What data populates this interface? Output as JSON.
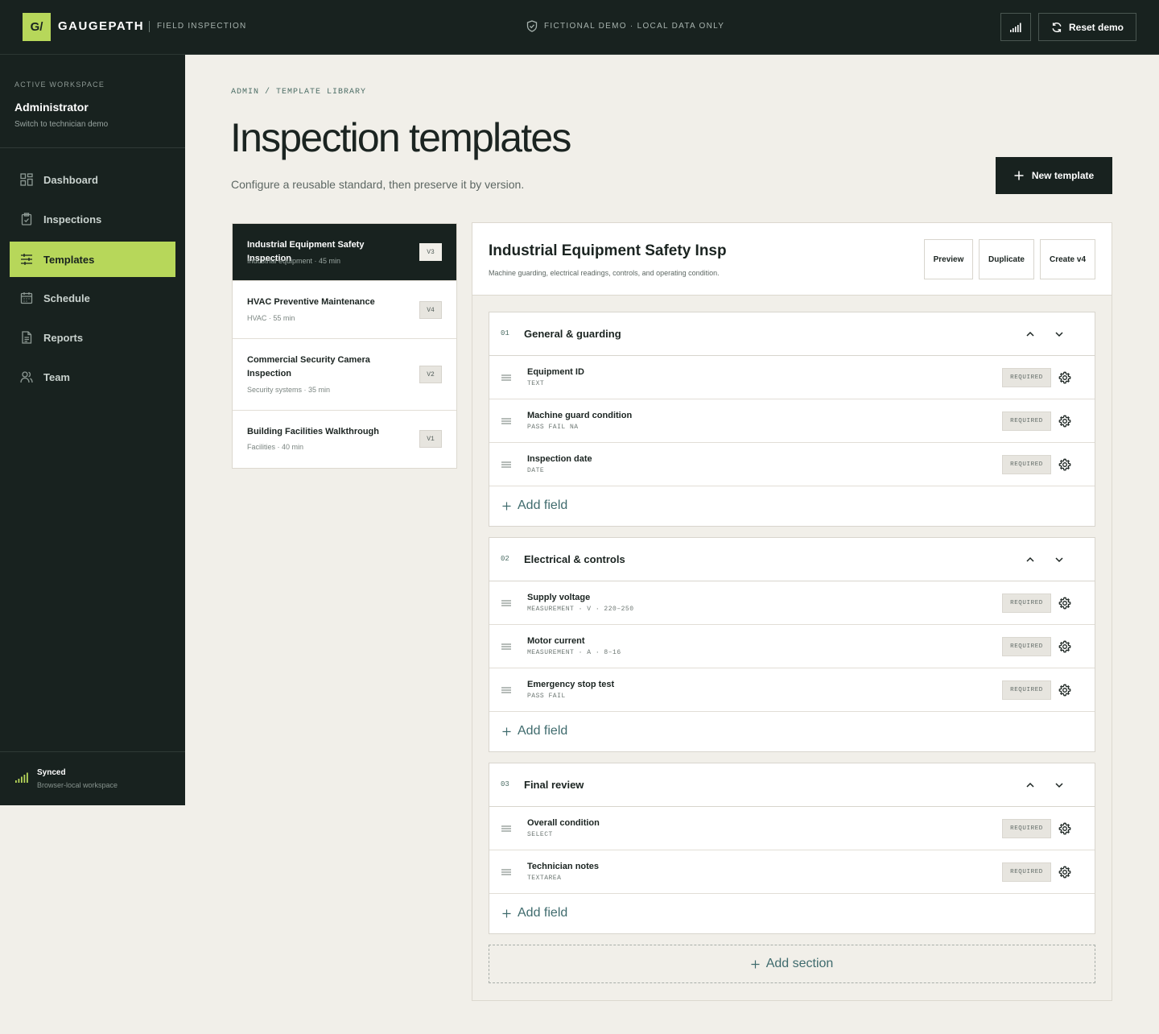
{
  "app": {
    "logo_mark": "G/",
    "brand": "GAUGEPATH",
    "subtitle": "FIELD INSPECTION",
    "demo_notice": "FICTIONAL DEMO · LOCAL DATA ONLY",
    "reset_label": "Reset demo",
    "accent": "#b7d75a",
    "dark": "#18221f"
  },
  "sidebar": {
    "workspace_label": "ACTIVE WORKSPACE",
    "workspace_name": "Administrator",
    "switch_label": "Switch to technician demo",
    "items": [
      {
        "label": "Dashboard",
        "icon": "dashboard-icon"
      },
      {
        "label": "Inspections",
        "icon": "clipboard-icon"
      },
      {
        "label": "Templates",
        "icon": "sliders-icon",
        "active": true
      },
      {
        "label": "Schedule",
        "icon": "calendar-icon"
      },
      {
        "label": "Reports",
        "icon": "document-icon"
      },
      {
        "label": "Team",
        "icon": "users-icon"
      }
    ],
    "sync_title": "Synced",
    "sync_sub": "Browser-local workspace"
  },
  "page": {
    "breadcrumb": "ADMIN / TEMPLATE LIBRARY",
    "title": "Inspection templates",
    "subtitle": "Configure a reusable standard, then preserve it by version.",
    "new_template_label": "New template"
  },
  "templates": [
    {
      "name": "Industrial Equipment Safety Inspection",
      "meta": "Industrial equipment · 45 min",
      "version": "V3",
      "active": true
    },
    {
      "name": "HVAC Preventive Maintenance",
      "meta": "HVAC · 55 min",
      "version": "V4"
    },
    {
      "name": "Commercial Security Camera Inspection",
      "meta": "Security systems · 35 min",
      "version": "V2"
    },
    {
      "name": "Building Facilities Walkthrough",
      "meta": "Facilities · 40 min",
      "version": "V1"
    }
  ],
  "editor": {
    "title": "Industrial Equipment Safety Insp",
    "subtitle": "Machine guarding, electrical readings, controls, and operating condition.",
    "preview_label": "Preview",
    "duplicate_label": "Duplicate",
    "create_label": "Create v4",
    "required_label": "REQUIRED",
    "add_field_label": "Add field",
    "add_section_label": "Add section",
    "sections": [
      {
        "num": "01",
        "title": "General & guarding",
        "fields": [
          {
            "name": "Equipment ID",
            "type": "TEXT"
          },
          {
            "name": "Machine guard condition",
            "type": "PASS FAIL NA"
          },
          {
            "name": "Inspection date",
            "type": "DATE"
          }
        ]
      },
      {
        "num": "02",
        "title": "Electrical & controls",
        "fields": [
          {
            "name": "Supply voltage",
            "type": "MEASUREMENT · V · 220–250"
          },
          {
            "name": "Motor current",
            "type": "MEASUREMENT · A · 8–16"
          },
          {
            "name": "Emergency stop test",
            "type": "PASS FAIL"
          }
        ]
      },
      {
        "num": "03",
        "title": "Final review",
        "fields": [
          {
            "name": "Overall condition",
            "type": "SELECT"
          },
          {
            "name": "Technician notes",
            "type": "TEXTAREA"
          }
        ]
      }
    ]
  }
}
